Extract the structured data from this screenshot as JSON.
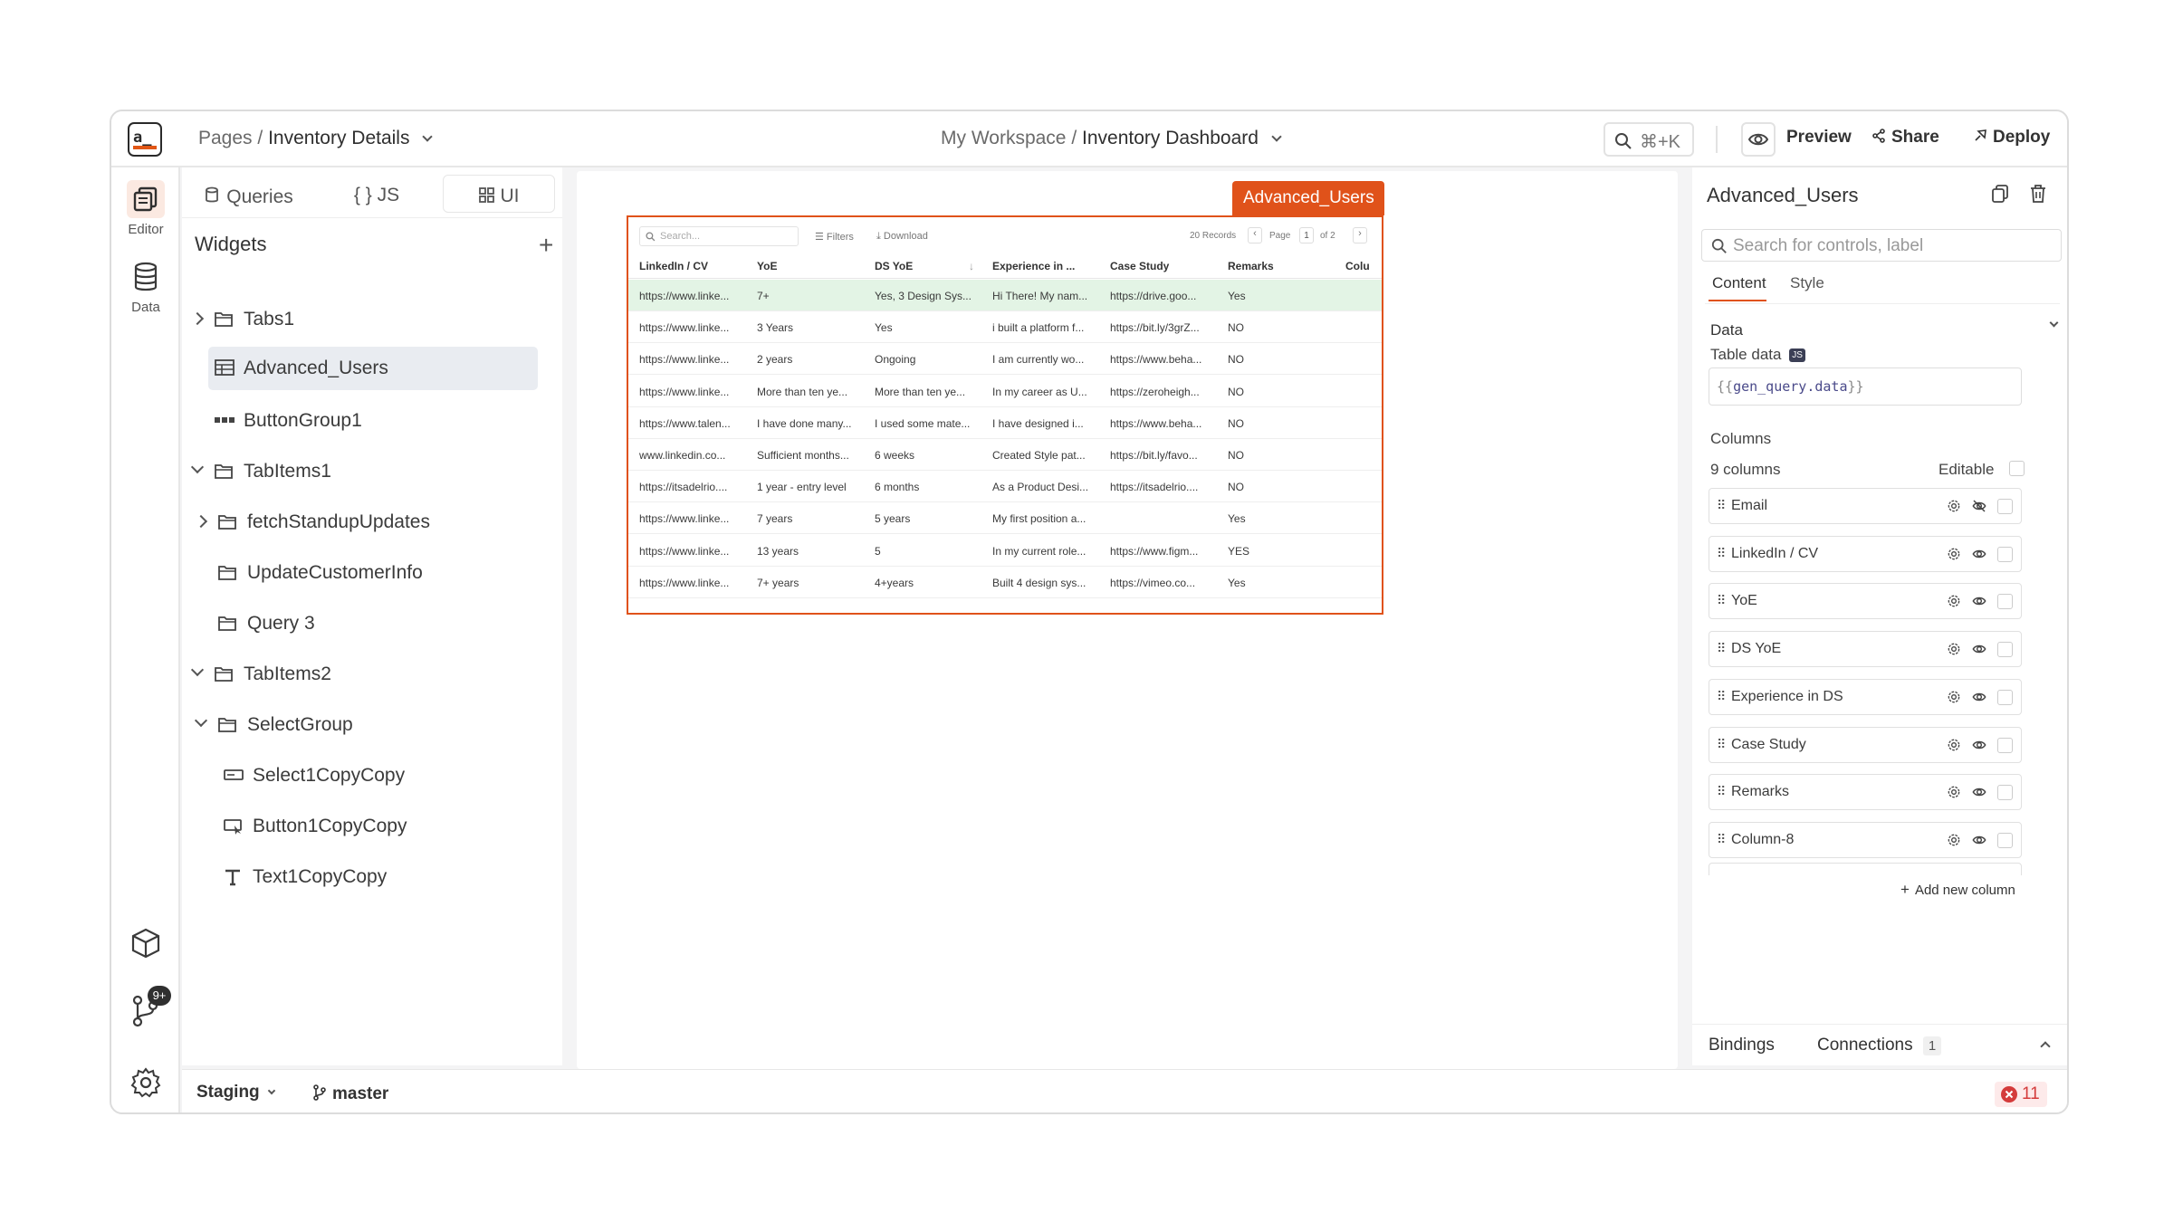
{
  "header": {
    "logo_text": "a_",
    "pages_prefix": "Pages /",
    "page_name": "Inventory Details",
    "workspace_prefix": "My Workspace /",
    "app_name": "Inventory Dashboard",
    "search_shortcut": "⌘+K",
    "preview_label": "Preview",
    "share_label": "Share",
    "deploy_label": "Deploy"
  },
  "rail": {
    "editor_label": "Editor",
    "data_label": "Data",
    "git_badge": "9+"
  },
  "left_panel": {
    "tabs": [
      {
        "label": "Queries",
        "icon": "queries-icon"
      },
      {
        "label": "{ } JS",
        "icon": "js-icon"
      },
      {
        "label": "UI",
        "icon": "ui-grid-icon"
      }
    ],
    "widgets_title": "Widgets",
    "tree": [
      {
        "label": "Tabs1",
        "icon": "folder-icon",
        "caret": "right",
        "depth": 0
      },
      {
        "label": "Advanced_Users",
        "icon": "table-icon",
        "caret": "none",
        "depth": 0,
        "selected": true
      },
      {
        "label": "ButtonGroup1",
        "icon": "button-group-icon",
        "caret": "none",
        "depth": 0
      },
      {
        "label": "TabItems1",
        "icon": "folder-icon",
        "caret": "down",
        "depth": 0
      },
      {
        "label": "fetchStandupUpdates",
        "icon": "folder-icon",
        "caret": "right",
        "depth": 1
      },
      {
        "label": "UpdateCustomerInfo",
        "icon": "folder-icon",
        "caret": "none",
        "depth": 1
      },
      {
        "label": "Query 3",
        "icon": "folder-icon",
        "caret": "none",
        "depth": 1
      },
      {
        "label": "TabItems2",
        "icon": "folder-icon",
        "caret": "down",
        "depth": 0
      },
      {
        "label": "SelectGroup",
        "icon": "folder-icon",
        "caret": "down",
        "depth": 1
      },
      {
        "label": "Select1CopyCopy",
        "icon": "select-icon",
        "caret": "none",
        "depth": 2
      },
      {
        "label": "Button1CopyCopy",
        "icon": "button-icon",
        "caret": "none",
        "depth": 2
      },
      {
        "label": "Text1CopyCopy",
        "icon": "text-icon",
        "caret": "none",
        "depth": 2
      }
    ]
  },
  "canvas": {
    "widget_tag": "Advanced_Users",
    "table": {
      "search_placeholder": "Search...",
      "filters_label": "Filters",
      "download_label": "Download",
      "records": "20 Records",
      "page_label": "Page",
      "page_current": "1",
      "page_of": "of 2",
      "columns": [
        "LinkedIn / CV",
        "YoE",
        "DS YoE",
        "Experience in ...",
        "Case Study",
        "Remarks",
        "Colu"
      ],
      "rows": [
        [
          "https://www.linke...",
          "7+",
          "Yes, 3 Design Sys...",
          "Hi There! My nam...",
          "https://drive.goo...",
          "Yes"
        ],
        [
          "https://www.linke...",
          "3 Years",
          "Yes",
          "i built a platform f...",
          "https://bit.ly/3grZ...",
          "NO"
        ],
        [
          "https://www.linke...",
          "2 years",
          "Ongoing",
          "I am currently wo...",
          "https://www.beha...",
          "NO"
        ],
        [
          "https://www.linke...",
          "More than ten ye...",
          "More than ten ye...",
          "In my career as U...",
          "https://zeroheigh...",
          "NO"
        ],
        [
          "https://www.talen...",
          "I have done many...",
          "I used some mate...",
          "I have designed i...",
          "https://www.beha...",
          "NO"
        ],
        [
          "www.linkedin.co...",
          "Sufficient months...",
          "6 weeks",
          "Created Style pat...",
          "https://bit.ly/favo...",
          "NO"
        ],
        [
          "https://itsadelrio....",
          "1 year - entry level",
          "6 months",
          "As a Product Desi...",
          "https://itsadelrio....",
          "NO"
        ],
        [
          "https://www.linke...",
          "7 years",
          "5 years",
          "My first position a...",
          "",
          "Yes"
        ],
        [
          "https://www.linke...",
          "13 years",
          "5",
          "In my current role...",
          "https://www.figm...",
          "YES"
        ],
        [
          "https://www.linke...",
          "7+ years",
          "4+years",
          "Built 4 design sys...",
          "https://vimeo.co...",
          "Yes"
        ]
      ]
    }
  },
  "right_panel": {
    "title": "Advanced_Users",
    "search_placeholder": "Search for controls, label",
    "tabs": [
      "Content",
      "Style"
    ],
    "section_data": "Data",
    "table_data_label": "Table data",
    "table_data_badge": "JS",
    "table_data_open": "{{",
    "table_data_value": "gen_query.data",
    "table_data_close": "}}",
    "columns_label": "Columns",
    "columns_count": "9 columns",
    "editable_label": "Editable",
    "columns": [
      {
        "name": "Email",
        "visible": false
      },
      {
        "name": "LinkedIn / CV",
        "visible": true
      },
      {
        "name": "YoE",
        "visible": true
      },
      {
        "name": "DS YoE",
        "visible": true
      },
      {
        "name": "Experience in DS",
        "visible": true
      },
      {
        "name": "Case Study",
        "visible": true
      },
      {
        "name": "Remarks",
        "visible": true
      },
      {
        "name": "Column-8",
        "visible": true
      }
    ],
    "add_column_label": "Add new column",
    "bindings_label": "Bindings",
    "connections_label": "Connections",
    "connections_count": "1"
  },
  "bottom_bar": {
    "environment": "Staging",
    "branch": "master",
    "error_count": "11"
  },
  "colors": {
    "accent": "#e0521a",
    "selected_row": "#e3f4e5",
    "selected_tree": "#e9ecf1",
    "error": "#d43b3b"
  }
}
